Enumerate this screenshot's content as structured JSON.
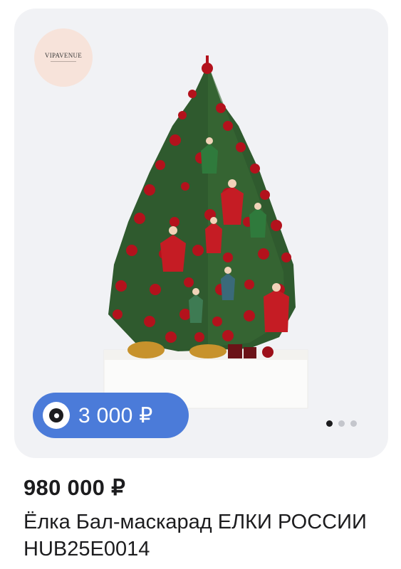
{
  "card": {
    "logo_text": "VIPAVENUE",
    "badge_price": "3 000 ₽",
    "carousel": {
      "count": 3,
      "active": 0
    }
  },
  "product": {
    "price": "980 000 ₽",
    "title": "Ёлка Бал-маскарад ЕЛКИ РОССИИ HUB25E0014"
  },
  "colors": {
    "card_bg": "#f1f2f5",
    "badge_bg": "#4b7bd9",
    "logo_bg": "#f7e3da",
    "tree_green": "#2f5a2e",
    "ornament_red": "#b3121c"
  },
  "icons": {
    "badge_icon": "coin-icon"
  }
}
